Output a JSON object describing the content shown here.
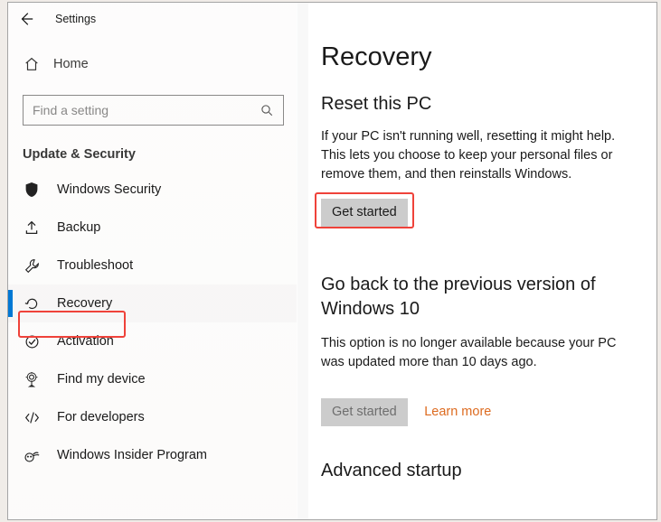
{
  "title": "Settings",
  "home": "Home",
  "search_placeholder": "Find a setting",
  "section_header": "Update & Security",
  "nav": {
    "windows_security": "Windows Security",
    "backup": "Backup",
    "troubleshoot": "Troubleshoot",
    "recovery": "Recovery",
    "activation": "Activation",
    "find_my_device": "Find my device",
    "for_developers": "For developers",
    "windows_insider": "Windows Insider Program"
  },
  "page": {
    "heading": "Recovery",
    "reset": {
      "title": "Reset this PC",
      "body": "If your PC isn't running well, resetting it might help. This lets you choose to keep your personal files or remove them, and then reinstalls Windows.",
      "button": "Get started"
    },
    "goback": {
      "title": "Go back to the previous version of Windows 10",
      "body": "This option is no longer available because your PC was updated more than 10 days ago.",
      "button": "Get started"
    },
    "learn_more": "Learn more",
    "advanced": "Advanced startup"
  }
}
